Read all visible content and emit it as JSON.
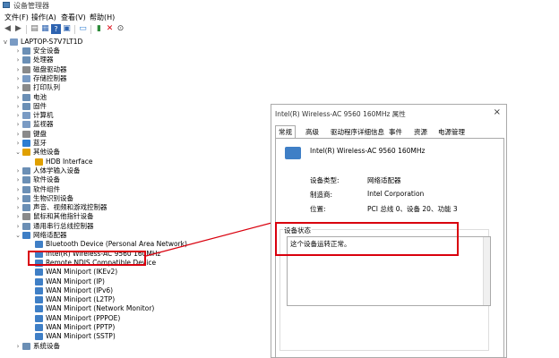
{
  "window": {
    "title": "设备管理器"
  },
  "menu": [
    "文件(F)",
    "操作(A)",
    "查看(V)",
    "帮助(H)"
  ],
  "toolbar": {
    "icons": [
      "back-icon",
      "forward-icon",
      "properties-icon",
      "help-icon",
      "scan-icon",
      "display-icon",
      "update-driver-icon",
      "uninstall-icon",
      "disable-icon"
    ]
  },
  "tree": {
    "root": "LAPTOP-S7V7LT1D",
    "nodes": [
      {
        "label": "安全设备",
        "toggle": ">",
        "depth": 1,
        "icon": "gen"
      },
      {
        "label": "处理器",
        "toggle": ">",
        "depth": 1,
        "icon": "gen"
      },
      {
        "label": "磁盘驱动器",
        "toggle": ">",
        "depth": 1,
        "icon": "gray"
      },
      {
        "label": "存储控制器",
        "toggle": ">",
        "depth": 1,
        "icon": "dev"
      },
      {
        "label": "打印队列",
        "toggle": ">",
        "depth": 1,
        "icon": "gray"
      },
      {
        "label": "电池",
        "toggle": ">",
        "depth": 1,
        "icon": "gen"
      },
      {
        "label": "固件",
        "toggle": ">",
        "depth": 1,
        "icon": "gen"
      },
      {
        "label": "计算机",
        "toggle": ">",
        "depth": 1,
        "icon": "dev"
      },
      {
        "label": "监视器",
        "toggle": ">",
        "depth": 1,
        "icon": "dev"
      },
      {
        "label": "键盘",
        "toggle": ">",
        "depth": 1,
        "icon": "gray"
      },
      {
        "label": "蓝牙",
        "toggle": ">",
        "depth": 1,
        "icon": "blue"
      },
      {
        "label": "其他设备",
        "toggle": "v",
        "depth": 1,
        "icon": "warn"
      },
      {
        "label": "HDB Interface",
        "toggle": "",
        "depth": 2,
        "icon": "warn"
      },
      {
        "label": "人体学输入设备",
        "toggle": ">",
        "depth": 1,
        "icon": "gen"
      },
      {
        "label": "软件设备",
        "toggle": ">",
        "depth": 1,
        "icon": "gen"
      },
      {
        "label": "软件组件",
        "toggle": ">",
        "depth": 1,
        "icon": "gen"
      },
      {
        "label": "生物识别设备",
        "toggle": ">",
        "depth": 1,
        "icon": "gen"
      },
      {
        "label": "声音、视频和游戏控制器",
        "toggle": ">",
        "depth": 1,
        "icon": "gen"
      },
      {
        "label": "鼠标和其他指针设备",
        "toggle": ">",
        "depth": 1,
        "icon": "gray"
      },
      {
        "label": "通用串行总线控制器",
        "toggle": ">",
        "depth": 1,
        "icon": "gen"
      },
      {
        "label": "网络适配器",
        "toggle": "v",
        "depth": 1,
        "icon": "net"
      },
      {
        "label": "Bluetooth Device (Personal Area Network)",
        "toggle": "",
        "depth": 2,
        "icon": "net"
      },
      {
        "label": "Intel(R) Wireless-AC 9560 160MHz",
        "toggle": "",
        "depth": 2,
        "icon": "net"
      },
      {
        "label": "Remote NDIS Compatible Device",
        "toggle": "",
        "depth": 2,
        "icon": "net"
      },
      {
        "label": "WAN Miniport (IKEv2)",
        "toggle": "",
        "depth": 2,
        "icon": "net"
      },
      {
        "label": "WAN Miniport (IP)",
        "toggle": "",
        "depth": 2,
        "icon": "net"
      },
      {
        "label": "WAN Miniport (IPv6)",
        "toggle": "",
        "depth": 2,
        "icon": "net"
      },
      {
        "label": "WAN Miniport (L2TP)",
        "toggle": "",
        "depth": 2,
        "icon": "net"
      },
      {
        "label": "WAN Miniport (Network Monitor)",
        "toggle": "",
        "depth": 2,
        "icon": "net"
      },
      {
        "label": "WAN Miniport (PPPOE)",
        "toggle": "",
        "depth": 2,
        "icon": "net"
      },
      {
        "label": "WAN Miniport (PPTP)",
        "toggle": "",
        "depth": 2,
        "icon": "net"
      },
      {
        "label": "WAN Miniport (SSTP)",
        "toggle": "",
        "depth": 2,
        "icon": "net"
      },
      {
        "label": "系统设备",
        "toggle": ">",
        "depth": 1,
        "icon": "gen"
      }
    ]
  },
  "dialog": {
    "title": "Intel(R) Wireless-AC 9560 160MHz 属性",
    "close": "×",
    "tabs": [
      "常规",
      "高级",
      "驱动程序",
      "详细信息",
      "事件",
      "资源",
      "电源管理"
    ],
    "device_name": "Intel(R) Wireless-AC 9560 160MHz",
    "props": [
      {
        "label": "设备类型:",
        "value": "网络适配器"
      },
      {
        "label": "制造商:",
        "value": "Intel Corporation"
      },
      {
        "label": "位置:",
        "value": "PCI 总线 0、设备 20、功能 3"
      }
    ],
    "status_legend": "设备状态",
    "status_text": "这个设备运转正常。"
  },
  "colors": {
    "highlight": "#d9000d",
    "net_icon": "#3f7fc6"
  }
}
